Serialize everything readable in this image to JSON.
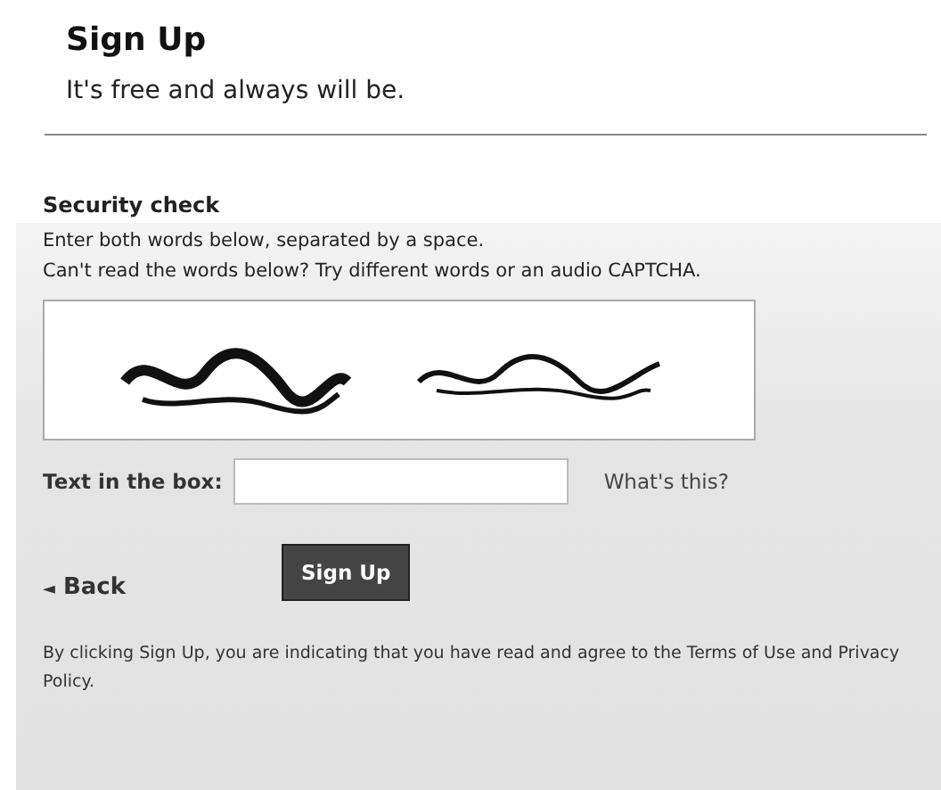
{
  "header": {
    "title": "Sign Up",
    "subtitle": "It's free and always will be."
  },
  "security": {
    "title": "Security check",
    "instructions": [
      "Enter both words below, separated by a space.",
      "Can't read the words below? Try different words or an audio CAPTCHA."
    ],
    "field": {
      "label": "Text in the box:",
      "help_link": "What's this?"
    },
    "back_link": {
      "icon": "◄",
      "label": "Back"
    },
    "submit_button": "Sign Up",
    "legal": "By clicking Sign Up, you are indicating that you have read and agree to the Terms of Use and Privacy Policy."
  }
}
